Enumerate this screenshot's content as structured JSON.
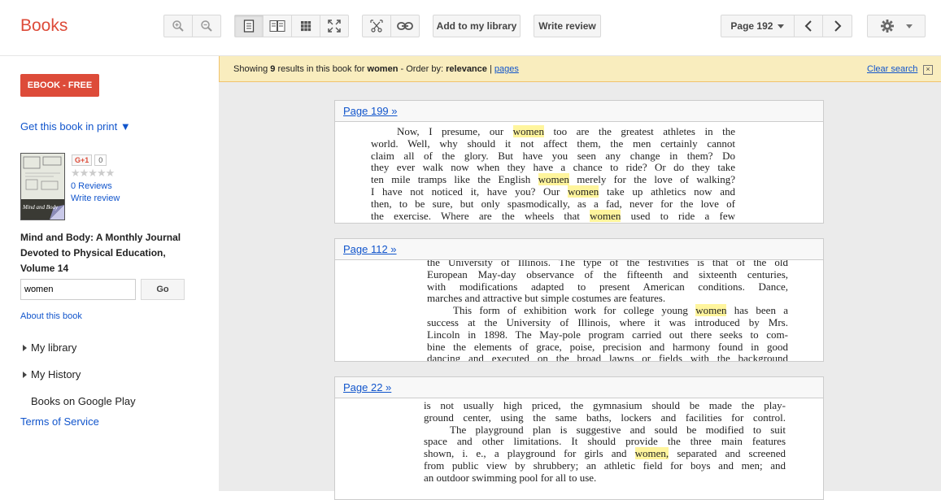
{
  "header": {
    "brand": "Books",
    "add_library_label": "Add to my library",
    "write_review_label": "Write review",
    "page_label": "Page 192"
  },
  "sidebar": {
    "ebook_label": "EBOOK - FREE",
    "get_book_label": "Get this book in print ▼",
    "gplus_label": "G+1",
    "gplus_count": "0",
    "stars": "★★★★★",
    "reviews_label": "0 Reviews",
    "write_review_label": "Write review",
    "book_title": "Mind and Body: A Monthly Journal Devoted to Physical Education, Volume 14",
    "cover_caption": "Mind and Body",
    "search_value": "women",
    "go_label": "Go",
    "about_label": "About this book",
    "nav": [
      "My library",
      "My History",
      "Books on Google Play"
    ],
    "terms_label": "Terms of Service"
  },
  "notice": {
    "showing": "Showing",
    "count": "9",
    "mid": "results in this book for",
    "query": "women",
    "dash": "-  Order by:",
    "order": "relevance",
    "sep": "|",
    "pages": "pages",
    "clear": "Clear search",
    "close_glyph": "×"
  },
  "results": [
    {
      "page_link": "Page 199 »",
      "lines": [
        [
          {
            "t": "Now, I presume, our "
          },
          {
            "t": "women",
            "h": true
          },
          {
            "t": " too are the greatest athletes in the"
          }
        ],
        [
          {
            "t": "world. Well, why should it not affect them, the men certainly cannot"
          }
        ],
        [
          {
            "t": "claim all of the glory. But have you seen any change in them? Do"
          }
        ],
        [
          {
            "t": "they ever walk now when they have a chance to ride? Or do they take"
          }
        ],
        [
          {
            "t": "ten mile tramps like the English "
          },
          {
            "t": "women",
            "h": true
          },
          {
            "t": " merely for the love of walking?"
          }
        ],
        [
          {
            "t": "I have not noticed it, have you? Our "
          },
          {
            "t": "women",
            "h": true
          },
          {
            "t": " take up athletics now and"
          }
        ],
        [
          {
            "t": "then, to be sure, but only spasmodically, as a fad, never for the love of"
          }
        ],
        [
          {
            "t": "the exercise. Where are the wheels that "
          },
          {
            "t": "women",
            "h": true
          },
          {
            "t": " used to ride a few"
          }
        ]
      ]
    },
    {
      "page_link": "Page 112 »",
      "lines": [
        [
          {
            "t": "the University of Illinois. The type of the festivities is that of the old"
          }
        ],
        [
          {
            "t": "European May-day observance of the fifteenth and sixteenth centuries,"
          }
        ],
        [
          {
            "t": "with modifications adapted to present American conditions. Dance,"
          }
        ],
        [
          {
            "t": "marches and attractive but simple costumes are features."
          }
        ],
        [
          {
            "t": "This form of exhibition work for college young "
          },
          {
            "t": "women",
            "h": true
          },
          {
            "t": " has been a"
          }
        ],
        [
          {
            "t": "success at the University of Illinois, where it was introduced by Mrs."
          }
        ],
        [
          {
            "t": "Lincoln in 1898. The May-pole program carried out there seeks to com-"
          }
        ],
        [
          {
            "t": "bine the elements of grace, poise, precision and harmony found in good"
          }
        ],
        [
          {
            "t": "dancing and executed on the broad lawns or fields with the background"
          }
        ]
      ]
    },
    {
      "page_link": "Page 22 »",
      "lines": [
        [
          {
            "t": "is not usually high priced, the gymnasium should be made the play-"
          }
        ],
        [
          {
            "t": "ground center, using the same baths, lockers and facilities for control."
          }
        ],
        [
          {
            "t": "The playground plan is suggestive and sould be modified to suit"
          }
        ],
        [
          {
            "t": "space and other limitations. It should provide the three main features"
          }
        ],
        [
          {
            "t": "shown, i. e., a playground for girls and "
          },
          {
            "t": "women,",
            "h": true
          },
          {
            "t": " separated and screened"
          }
        ],
        [
          {
            "t": "from public view by shrubbery; an athletic field for boys and men; and"
          }
        ],
        [
          {
            "t": "an outdoor swimming pool for all to use."
          }
        ]
      ]
    }
  ]
}
